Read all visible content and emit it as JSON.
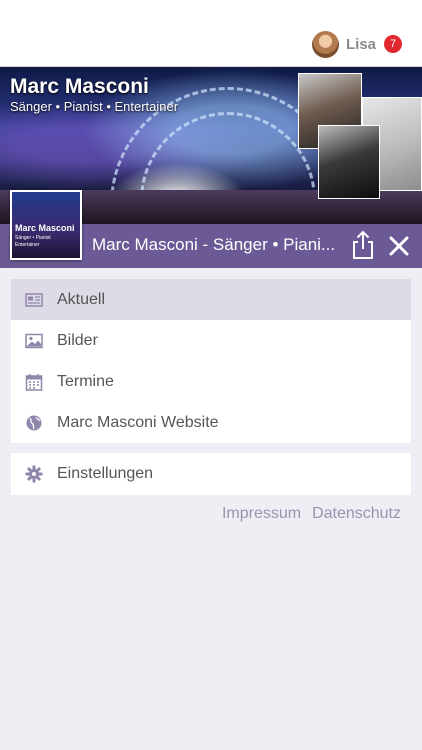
{
  "user": {
    "name": "Lisa",
    "badge_count": "7"
  },
  "banner": {
    "title": "Marc Masconi",
    "subtitle": "Sänger • Pianist • Entertainer",
    "thumb_title": "Marc Masconi",
    "thumb_subtitle": "Sänger • Pianist Entertainer"
  },
  "titlebar": {
    "title": "Marc Masconi - Sänger • Piani..."
  },
  "menu": {
    "items": [
      {
        "label": "Aktuell",
        "icon": "newspaper-icon",
        "active": true
      },
      {
        "label": "Bilder",
        "icon": "image-icon"
      },
      {
        "label": "Termine",
        "icon": "calendar-icon"
      },
      {
        "label": "Marc Masconi Website",
        "icon": "globe-icon"
      }
    ],
    "settings": {
      "label": "Einstellungen",
      "icon": "gear-icon"
    }
  },
  "footer": {
    "impressum": "Impressum",
    "datenschutz": "Datenschutz"
  },
  "colors": {
    "accent": "#6c5a96",
    "active_row": "#dedbe7",
    "background": "#efeef4",
    "badge": "#e0282f",
    "icon": "#8f86aa",
    "link": "#9a93b0"
  }
}
